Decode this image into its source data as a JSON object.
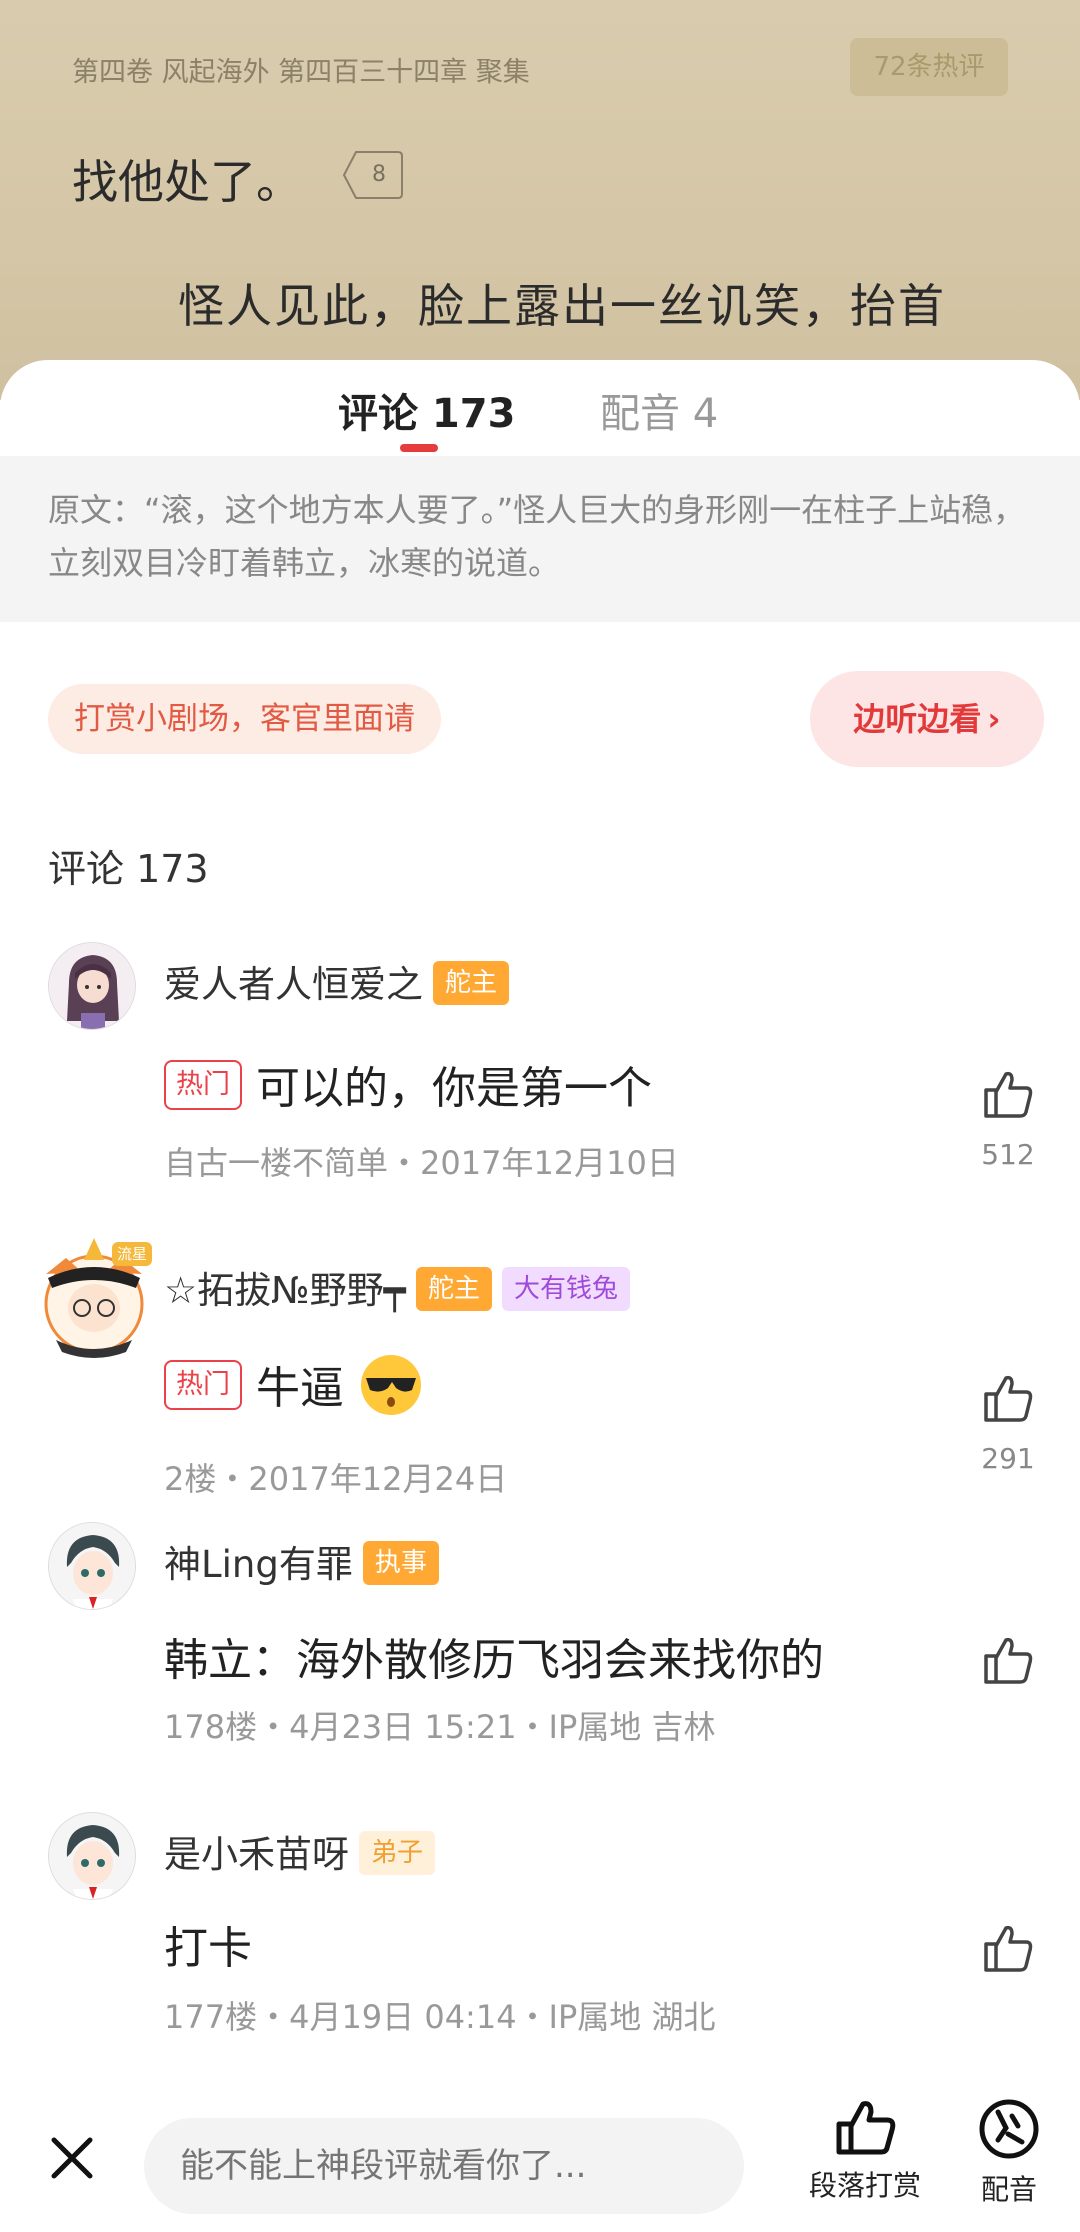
{
  "reader": {
    "chapter": "第四卷 风起海外 第四百三十四章 聚集",
    "hot_comments_badge": "72条热评",
    "line1": "找他处了。",
    "paragraph_comment_count": "8",
    "line2": "怪人见此，脸上露出一丝讥笑，抬首"
  },
  "tabs": [
    {
      "label": "评论 173",
      "active": true
    },
    {
      "label": "配音 4",
      "active": false
    }
  ],
  "quote": {
    "text": "原文：“滚，这个地方本人要了。”怪人巨大的身形刚一在柱子上站稳，立刻双目冷盯着韩立，冰寒的说道。"
  },
  "reward_banner": {
    "text": "打赏小剧场，客官里面请"
  },
  "listen_button": {
    "label": "边听边看",
    "chevron": "›"
  },
  "comments_heading": "评论 173",
  "comments": [
    {
      "username": "爱人者人恒爱之",
      "badges": [
        {
          "text": "舵主",
          "style": "orange"
        }
      ],
      "hot_tag": "热门",
      "text": "可以的，你是第一个",
      "meta": "自古一楼不简单・2017年12月10日",
      "likes": "512"
    },
    {
      "username": "☆拓拔№野野┯",
      "badges": [
        {
          "text": "舵主",
          "style": "orange"
        },
        {
          "text": "大有钱兔",
          "style": "purple"
        }
      ],
      "hot_tag": "热门",
      "text": "牛逼",
      "meta": "2楼・2017年12月24日",
      "likes": "291",
      "avatar_frame_text": "流星"
    },
    {
      "username": "神Ling有罪",
      "badges": [
        {
          "text": "执事",
          "style": "orange"
        }
      ],
      "text": "韩立：海外散修历飞羽会来找你的",
      "meta": "178楼・4月23日 15:21・IP属地 吉林",
      "likes": ""
    },
    {
      "username": "是小禾苗呀",
      "badges": [
        {
          "text": "弟子",
          "style": "light"
        }
      ],
      "text": "打卡",
      "meta": "177楼・4月19日 04:14・IP属地 湖北",
      "likes": ""
    }
  ],
  "bottom_bar": {
    "input_placeholder": "能不能上神段评就看你了...",
    "reward_label": "段落打赏",
    "dub_label": "配音"
  },
  "colors": {
    "accent_red": "#e73c3c",
    "badge_orange": "#ffa934",
    "reader_bg": "#d6c9aa"
  }
}
